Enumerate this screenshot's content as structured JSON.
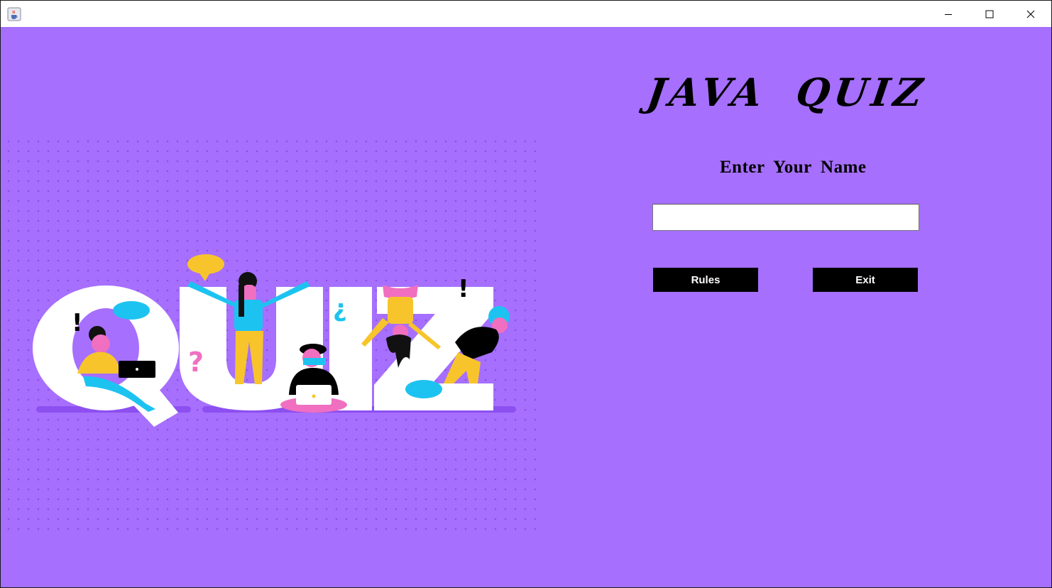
{
  "window": {
    "app_icon": "java-coffee-cup-icon",
    "controls": [
      "minimize-icon",
      "maximize-icon",
      "close-icon"
    ]
  },
  "illustration": {
    "letters": [
      "Q",
      "U",
      "I",
      "Z"
    ],
    "marks": [
      "!",
      "?",
      "¿",
      "!"
    ]
  },
  "main": {
    "title": "JAVA QUIZ",
    "name_label": "Enter Your Name",
    "name_input_value": "",
    "rules_label": "Rules",
    "exit_label": "Exit"
  },
  "colors": {
    "background": "#a66ffd",
    "button_bg": "#000000",
    "button_text": "#ffffff"
  }
}
